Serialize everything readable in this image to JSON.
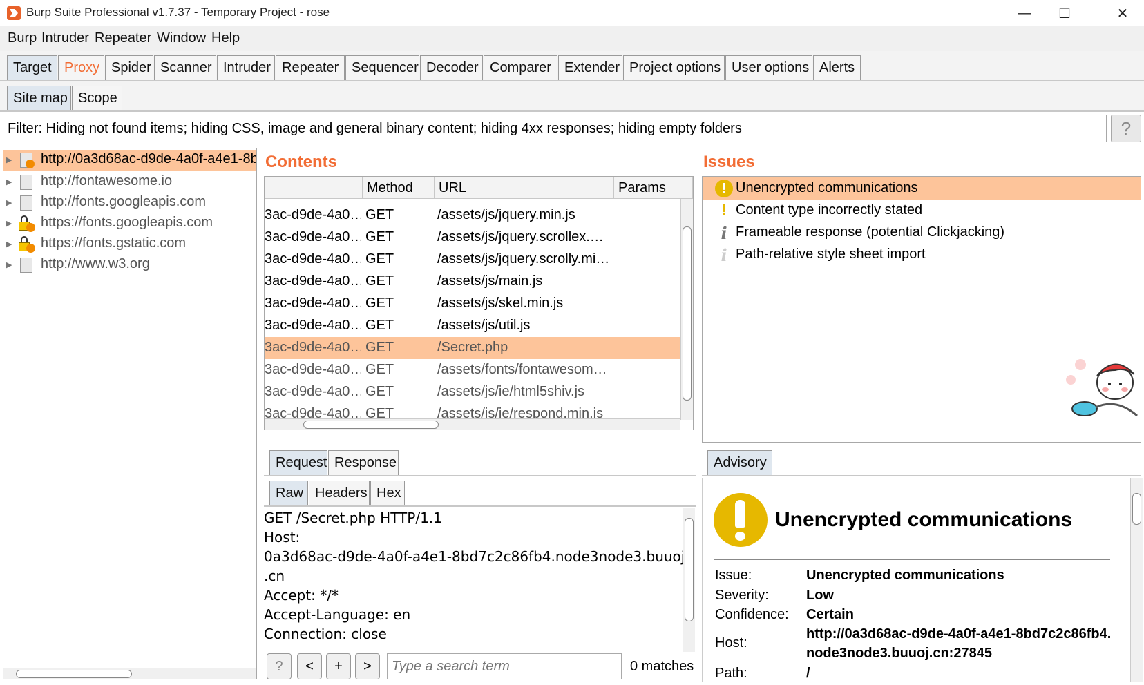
{
  "window": {
    "title": "Burp Suite Professional v1.7.37 - Temporary Project - rose",
    "minimize": "—",
    "maximize": "☐",
    "close": "✕"
  },
  "menu": [
    "Burp",
    "Intruder",
    "Repeater",
    "Window",
    "Help"
  ],
  "tabs": [
    "Target",
    "Proxy",
    "Spider",
    "Scanner",
    "Intruder",
    "Repeater",
    "Sequencer",
    "Decoder",
    "Comparer",
    "Extender",
    "Project options",
    "User options",
    "Alerts"
  ],
  "subtabs": [
    "Site map",
    "Scope"
  ],
  "filter": "Filter: Hiding not found items;  hiding CSS, image and general binary content;  hiding 4xx responses;  hiding empty folders",
  "help_label": "?",
  "sitemap": [
    {
      "label": "http://0a3d68ac-d9de-4a0f-a4e1-8b",
      "icon": "page-alert-icon",
      "selected": true
    },
    {
      "label": "http://fontawesome.io",
      "icon": "page-icon"
    },
    {
      "label": "http://fonts.googleapis.com",
      "icon": "page-icon"
    },
    {
      "label": "https://fonts.googleapis.com",
      "icon": "lock-alert-icon"
    },
    {
      "label": "https://fonts.gstatic.com",
      "icon": "lock-alert-icon"
    },
    {
      "label": "http://www.w3.org",
      "icon": "page-icon"
    }
  ],
  "contents": {
    "title": "Contents",
    "columns": [
      "Method",
      "URL",
      "Params"
    ],
    "rows": [
      {
        "host": "3ac-d9de-4a0…",
        "method": "GET",
        "url": "/assets/js/jquery.min.js"
      },
      {
        "host": "3ac-d9de-4a0…",
        "method": "GET",
        "url": "/assets/js/jquery.scrollex.…"
      },
      {
        "host": "3ac-d9de-4a0…",
        "method": "GET",
        "url": "/assets/js/jquery.scrolly.mi…"
      },
      {
        "host": "3ac-d9de-4a0…",
        "method": "GET",
        "url": "/assets/js/main.js"
      },
      {
        "host": "3ac-d9de-4a0…",
        "method": "GET",
        "url": "/assets/js/skel.min.js"
      },
      {
        "host": "3ac-d9de-4a0…",
        "method": "GET",
        "url": "/assets/js/util.js"
      },
      {
        "host": "3ac-d9de-4a0…",
        "method": "GET",
        "url": "/Secret.php",
        "selected": true
      },
      {
        "host": "3ac-d9de-4a0…",
        "method": "GET",
        "url": "/assets/fonts/fontawesom…",
        "dim": true
      },
      {
        "host": "3ac-d9de-4a0…",
        "method": "GET",
        "url": "/assets/js/ie/html5shiv.js",
        "dim": true
      },
      {
        "host": "3ac-d9de-4a0…",
        "method": "GET",
        "url": "/assets/js/ie/respond.min.js",
        "dim": true
      }
    ]
  },
  "issues": {
    "title": "Issues",
    "items": [
      {
        "label": "Unencrypted communications",
        "icon": "warning-circle-icon",
        "selected": true
      },
      {
        "label": "Content type incorrectly stated",
        "icon": "exclamation-icon"
      },
      {
        "label": "Frameable response (potential Clickjacking)",
        "icon": "info-icon"
      },
      {
        "label": "Path-relative style sheet import",
        "icon": "info-light-icon"
      }
    ]
  },
  "request": {
    "tabs": [
      "Request",
      "Response"
    ],
    "subtabs": [
      "Raw",
      "Headers",
      "Hex"
    ],
    "lines": [
      "GET /Secret.php HTTP/1.1",
      "Host:",
      "0a3d68ac-d9de-4a0f-a4e1-8bd7c2c86fb4.node3node3.buuoj",
      ".cn",
      "Accept: */*",
      "Accept-Language: en",
      "Connection: close"
    ],
    "buttons": [
      "?",
      "<",
      "+",
      ">"
    ],
    "search_placeholder": "Type a search term",
    "matches": "0 matches"
  },
  "advisory": {
    "tab": "Advisory",
    "heading": "Unencrypted communications",
    "fields": [
      {
        "label": "Issue:",
        "value": "Unencrypted communications"
      },
      {
        "label": "Severity:",
        "value": "Low"
      },
      {
        "label": "Confidence:",
        "value": "Certain"
      },
      {
        "label": "Host:",
        "value": "http://0a3d68ac-d9de-4a0f-a4e1-8bd7c2c86fb4.",
        "value2": "node3node3.buuoj.cn:27845"
      },
      {
        "label": "Path:",
        "value": "/"
      }
    ]
  },
  "colors": {
    "accent": "#f26d35",
    "selection": "#fdc49a",
    "warning": "#e6b800"
  }
}
